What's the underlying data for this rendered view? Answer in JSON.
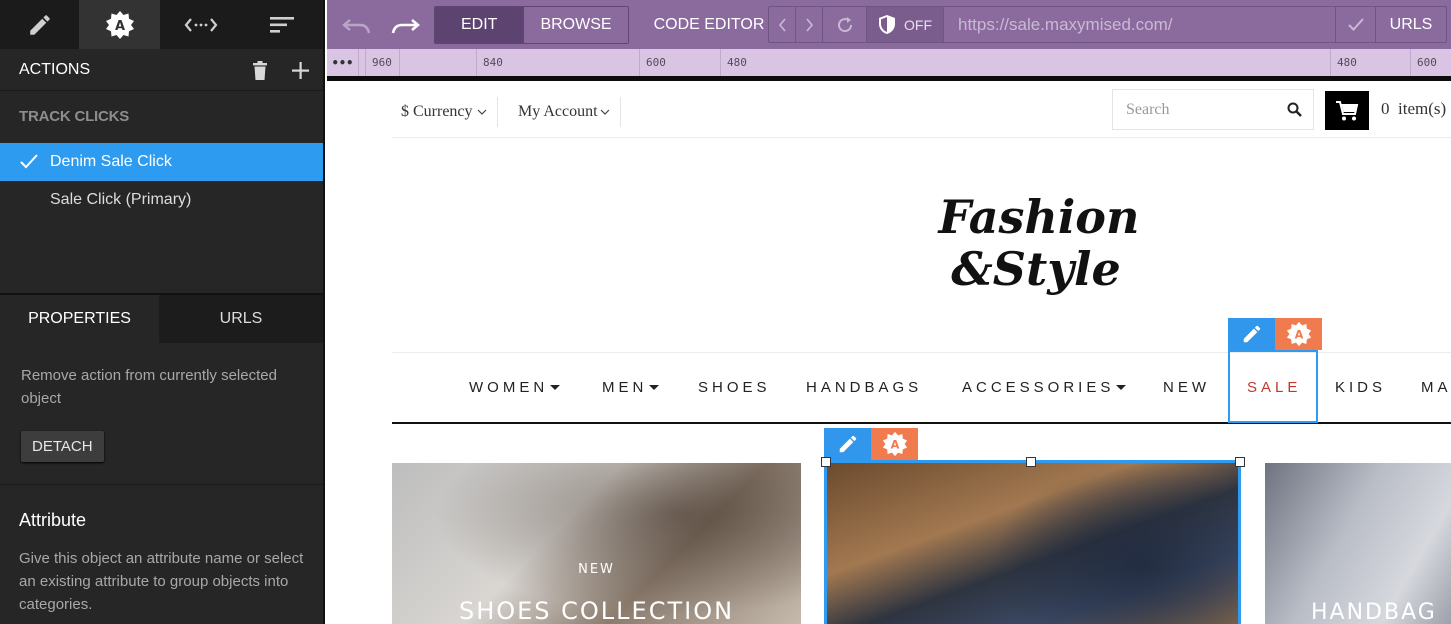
{
  "left_panel": {
    "tabs": [
      {
        "icon": "pencil-icon"
      },
      {
        "icon": "badge-a-icon",
        "active": true
      },
      {
        "icon": "code-arrows-icon"
      },
      {
        "icon": "sort-lines-icon"
      }
    ],
    "actions_title": "ACTIONS",
    "group_title": "TRACK CLICKS",
    "actions": [
      {
        "label": "Denim Sale Click",
        "selected": true
      },
      {
        "label": "Sale Click (Primary)",
        "selected": false
      }
    ],
    "properties_tab": "PROPERTIES",
    "urls_tab": "URLS",
    "properties_text": "Remove action from currently selected object",
    "detach_label": "DETACH",
    "attribute_title": "Attribute",
    "attribute_text": "Give this object an attribute name or select an existing attribute to group objects into categories."
  },
  "toolbar": {
    "edit_label": "EDIT",
    "browse_label": "BROWSE",
    "code_editor_label": "CODE EDITOR",
    "shield_state": "OFF",
    "url": "https://sale.maxymised.com/",
    "urls_label": "URLS",
    "accent": "#8b6b9e",
    "accent_dark": "#5d4470"
  },
  "ruler": {
    "dots": "•••",
    "ticks": [
      "960",
      "840",
      "600",
      "480",
      "480",
      "600"
    ]
  },
  "site": {
    "currency_label": "$ Currency",
    "account_label": "My Account",
    "search_placeholder": "Search",
    "cart_count": "0",
    "cart_suffix": "item(s)",
    "logo_line1": "Fashion",
    "logo_line2": "&Style",
    "nav": [
      "WOMEN",
      "MEN",
      "SHOES",
      "HANDBAGS",
      "ACCESSORIES",
      "NEW",
      "SALE",
      "KIDS",
      "MA"
    ],
    "sale_color": "#c0392b",
    "banners": [
      {
        "kicker": "NEW",
        "title": "SHOES COLLECTION"
      },
      {
        "kicker": "",
        "title": ""
      },
      {
        "kicker": "",
        "title": "HANDBAG"
      }
    ]
  },
  "colors": {
    "selection_blue": "#2f9bf0",
    "orange_badge": "#f07b4e"
  }
}
